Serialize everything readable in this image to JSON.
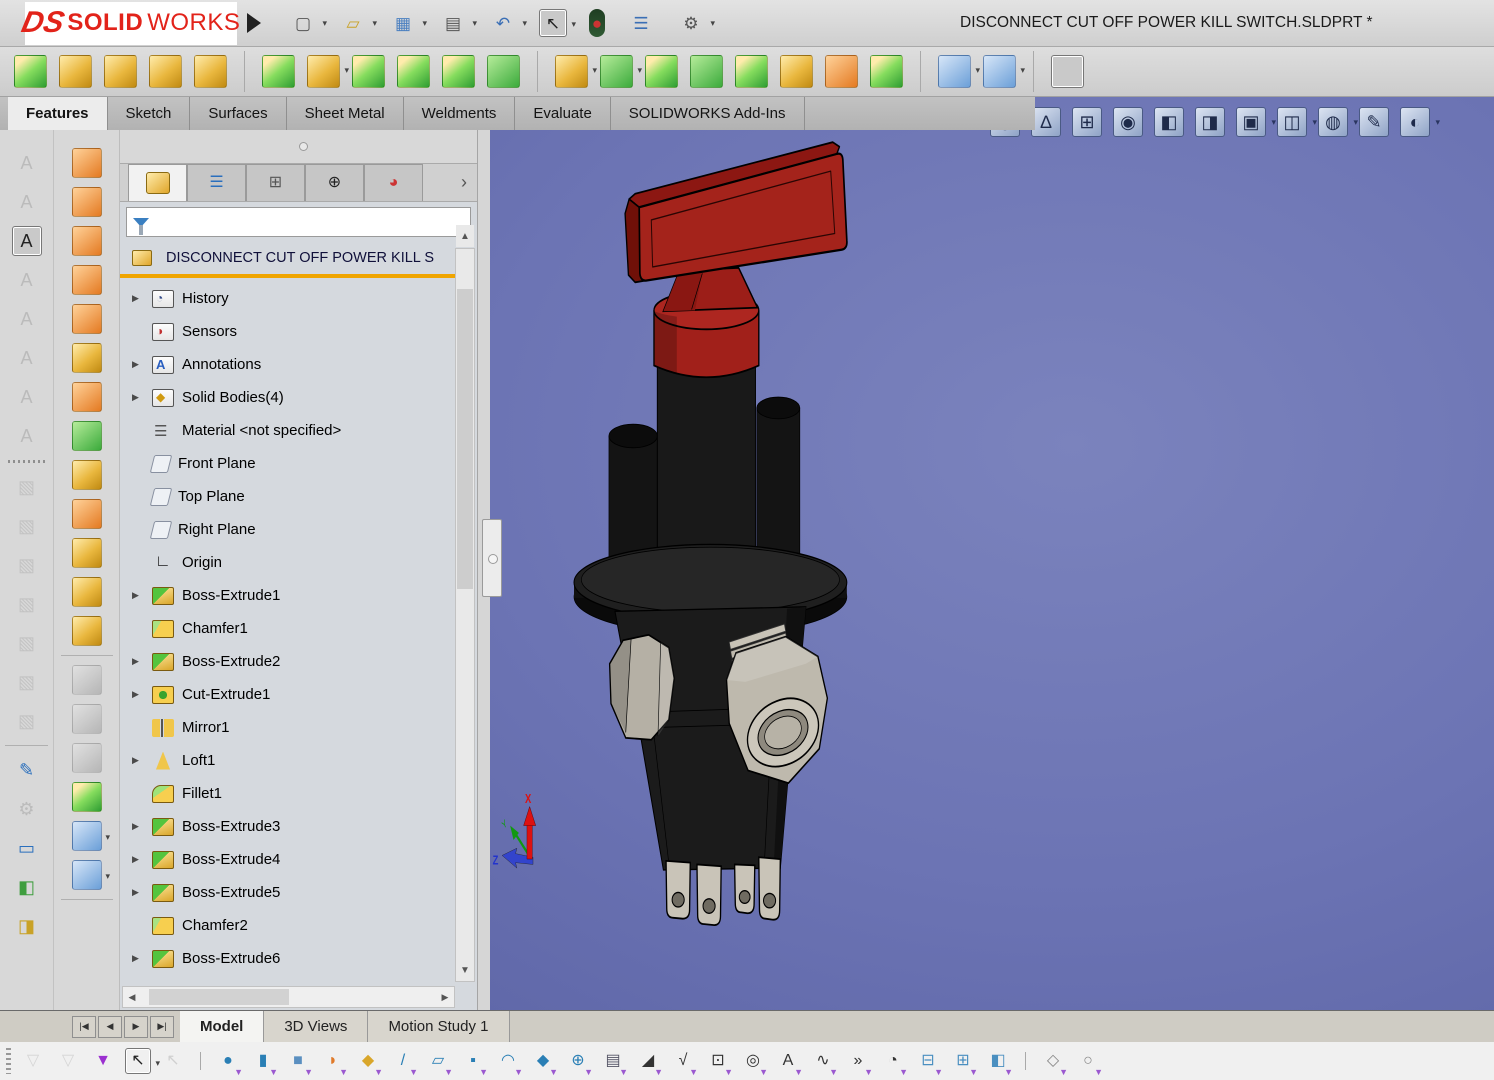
{
  "window": {
    "title": "DISCONNECT CUT OFF POWER KILL SWITCH.SLDPRT *"
  },
  "brand": {
    "prefix": "DS",
    "bold": "SOLID",
    "light": "WORKS"
  },
  "glyphs": {
    "expand": "▶",
    "scroll_up": "▲",
    "scroll_down": "▼",
    "scroll_left": "◀",
    "scroll_right": "▶",
    "chevron_right": "›",
    "nav_first": "|◀",
    "nav_prev": "◀",
    "nav_next": "▶",
    "nav_last": "▶|"
  },
  "quick_access_toolbar": {
    "icons": [
      {
        "name": "new-document-button",
        "glyph": "▢",
        "color": "#555",
        "cls": "",
        "dd": true
      },
      {
        "name": "open-document-button",
        "glyph": "▱",
        "color": "#c9a227",
        "cls": "",
        "dd": true
      },
      {
        "name": "save-button",
        "glyph": "▦",
        "color": "#4a7fc0",
        "cls": "",
        "dd": true
      },
      {
        "name": "print-button",
        "glyph": "▤",
        "color": "#555",
        "cls": "",
        "dd": true
      },
      {
        "name": "undo-button",
        "glyph": "↶",
        "color": "#3b6fb5",
        "cls": "",
        "dd": true
      },
      {
        "name": "select-arrow-button",
        "glyph": "↖",
        "color": "#222",
        "cls": "pressed",
        "dd": true
      },
      {
        "name": "traffic-light-icon",
        "glyph": "●",
        "color": "#cc3333",
        "cls": "traffic"
      },
      {
        "name": "view-settings-button",
        "glyph": "☰",
        "color": "#3b6fb5"
      },
      {
        "name": "options-gear-button",
        "glyph": "⚙",
        "color": "#555",
        "dd": true
      }
    ]
  },
  "features_toolbar": {
    "icons": [
      {
        "name": "extruded-boss-base-button",
        "cls": "chip goldgreen"
      },
      {
        "name": "revolved-boss-base-button",
        "cls": "chip gold"
      },
      {
        "name": "swept-boss-base-button",
        "cls": "chip gold"
      },
      {
        "name": "lofted-boss-base-button",
        "cls": "chip gold"
      },
      {
        "name": "boundary-boss-base-button",
        "cls": "chip gold"
      },
      {
        "sep": true
      },
      {
        "name": "extruded-cut-button",
        "cls": "chip goldgreen"
      },
      {
        "name": "hole-wizard-button",
        "cls": "chip gold",
        "dd": true
      },
      {
        "name": "revolved-cut-button",
        "cls": "chip goldgreen"
      },
      {
        "name": "swept-cut-button",
        "cls": "chip goldgreen"
      },
      {
        "name": "lofted-cut-button",
        "cls": "chip goldgreen"
      },
      {
        "name": "boundary-cut-button",
        "cls": "chip green"
      },
      {
        "sep": true
      },
      {
        "name": "fillet-button",
        "cls": "chip gold",
        "dd": true
      },
      {
        "name": "linear-pattern-button",
        "cls": "chip green",
        "dd": true
      },
      {
        "name": "draft-button",
        "cls": "chip goldgreen"
      },
      {
        "name": "rib-button",
        "cls": "chip green"
      },
      {
        "name": "shell-button",
        "cls": "chip goldgreen"
      },
      {
        "name": "wrap-button",
        "cls": "chip gold"
      },
      {
        "name": "intersect-button",
        "cls": "chip orange"
      },
      {
        "name": "mirror-feature-button",
        "cls": "chip goldgreen"
      },
      {
        "sep": true
      },
      {
        "name": "reference-geometry-button",
        "cls": "chip blue",
        "dd": true
      },
      {
        "name": "curves-button",
        "cls": "chip blue",
        "dd": true
      },
      {
        "sep": true
      },
      {
        "name": "instant3d-button",
        "cls": "chip blue pressed"
      }
    ]
  },
  "ribbon_tabs": {
    "tabs": [
      {
        "label": "Features",
        "active": true
      },
      {
        "label": "Sketch"
      },
      {
        "label": "Surfaces"
      },
      {
        "label": "Sheet Metal"
      },
      {
        "label": "Weldments"
      },
      {
        "label": "Evaluate"
      },
      {
        "label": "SOLIDWORKS Add-Ins"
      }
    ]
  },
  "headsup_toolbar": {
    "icons": [
      {
        "name": "zoom-to-fit-button",
        "glyph": "◎",
        "cls": "steel"
      },
      {
        "name": "measure-button",
        "glyph": "∆",
        "cls": "steel"
      },
      {
        "name": "zoom-to-area-button",
        "glyph": "⊞",
        "cls": "steel"
      },
      {
        "name": "magnified-selection-button",
        "glyph": "◉",
        "cls": "steel"
      },
      {
        "name": "previous-view-button",
        "glyph": "◧",
        "cls": "steel"
      },
      {
        "name": "section-view-button",
        "glyph": "◨",
        "cls": "steel"
      },
      {
        "name": "dynamic-annotation-views-button",
        "glyph": "▣",
        "cls": "steel",
        "dd": true
      },
      {
        "name": "view-orientation-button",
        "glyph": "◫",
        "cls": "steel",
        "dd": true
      },
      {
        "name": "hide-show-items-button",
        "glyph": "◍",
        "cls": "steel",
        "dd": true
      },
      {
        "name": "edit-appearance-button",
        "glyph": "✎",
        "cls": "steel"
      },
      {
        "name": "apply-scene-button",
        "glyph": "◐",
        "cls": "steel",
        "dd": true
      }
    ]
  },
  "left_toolbar_a": {
    "icons": [
      {
        "name": "note-tool-icon-1",
        "glyph": "A",
        "color": "#999",
        "cls": "grayed",
        "inter": false
      },
      {
        "name": "note-tool-icon-2",
        "glyph": "A",
        "color": "#999",
        "cls": "grayed",
        "inter": false
      },
      {
        "name": "spell-checker-button",
        "glyph": "A",
        "color": "#222",
        "cls": "pressed"
      },
      {
        "name": "note-tool-icon-4",
        "glyph": "A",
        "color": "#999",
        "cls": "grayed",
        "inter": false
      },
      {
        "name": "note-tool-icon-5",
        "glyph": "A",
        "color": "#999",
        "cls": "grayed",
        "inter": false
      },
      {
        "name": "note-tool-icon-6",
        "glyph": "A",
        "color": "#999",
        "cls": "grayed",
        "inter": false
      },
      {
        "name": "note-tool-icon-7",
        "glyph": "A",
        "color": "#999",
        "cls": "grayed",
        "inter": false
      },
      {
        "name": "note-tool-icon-8",
        "glyph": "A",
        "color": "#999",
        "cls": "grayed",
        "inter": false
      },
      {
        "sep": "dot"
      },
      {
        "name": "view-cube-icon-1",
        "glyph": "▧",
        "color": "#aaa",
        "cls": "grayed",
        "inter": false
      },
      {
        "name": "view-cube-icon-2",
        "glyph": "▧",
        "color": "#aaa",
        "cls": "grayed",
        "inter": false
      },
      {
        "name": "view-cube-icon-3",
        "glyph": "▧",
        "color": "#aaa",
        "cls": "grayed",
        "inter": false
      },
      {
        "name": "view-cube-icon-4",
        "glyph": "▧",
        "color": "#aaa",
        "cls": "grayed",
        "inter": false
      },
      {
        "name": "view-cube-icon-5",
        "glyph": "▧",
        "color": "#aaa",
        "cls": "grayed",
        "inter": false
      },
      {
        "name": "view-cube-icon-6",
        "glyph": "▧",
        "color": "#aaa",
        "cls": "grayed",
        "inter": false
      },
      {
        "name": "view-cube-icon-7",
        "glyph": "▧",
        "color": "#aaa",
        "cls": "grayed",
        "inter": false
      },
      {
        "sep": true
      },
      {
        "name": "new-sketch-button",
        "glyph": "✎",
        "color": "#2a6fbd"
      },
      {
        "name": "tools-button",
        "glyph": "⚙",
        "color": "#999",
        "cls": "grayed",
        "inter": false
      },
      {
        "name": "viewport-layout-button",
        "glyph": "▭",
        "color": "#2a6fbd"
      },
      {
        "name": "layer-stack-button-1",
        "glyph": "◧",
        "color": "#3f9e3f"
      },
      {
        "name": "layer-stack-button-2",
        "glyph": "◨",
        "color": "#c9a227"
      }
    ]
  },
  "left_toolbar_b": {
    "icons": [
      {
        "name": "extruded-surface-button",
        "cls": "chip orange"
      },
      {
        "name": "revolved-surface-button",
        "cls": "chip orange"
      },
      {
        "name": "swept-surface-button",
        "cls": "chip orange"
      },
      {
        "name": "lofted-surface-button",
        "cls": "chip orange"
      },
      {
        "name": "boundary-surface-button",
        "cls": "chip orange"
      },
      {
        "name": "filled-surface-button",
        "cls": "chip gold"
      },
      {
        "name": "planar-surface-button",
        "cls": "chip orange"
      },
      {
        "name": "offset-surface-button",
        "cls": "chip green"
      },
      {
        "name": "ruled-surface-button",
        "cls": "chip gold"
      },
      {
        "name": "radiate-surface-button",
        "cls": "chip orange"
      },
      {
        "name": "delete-face-button",
        "cls": "chip gold"
      },
      {
        "name": "replace-face-button",
        "cls": "chip gold"
      },
      {
        "name": "knit-surface-button",
        "cls": "chip gold"
      },
      {
        "sep": true
      },
      {
        "name": "extend-surface-button",
        "cls": "chip gold grayed",
        "inter": false
      },
      {
        "name": "trim-surface-button",
        "cls": "chip gold grayed",
        "inter": false
      },
      {
        "name": "untrim-surface-button",
        "cls": "chip gold grayed",
        "inter": false
      },
      {
        "name": "thicken-button",
        "cls": "chip goldgreen"
      },
      {
        "name": "reference-geometry-side-button",
        "cls": "chip blue",
        "dd": true
      },
      {
        "name": "curves-side-button",
        "cls": "chip blue",
        "dd": true
      },
      {
        "sep": true
      }
    ]
  },
  "feature_manager": {
    "panel_tabs": [
      {
        "name": "featuremanager-design-tree-tab",
        "cls": "ti-part",
        "active": true
      },
      {
        "name": "propertymanager-tab",
        "glyph": "☰",
        "color": "#2a6fbd"
      },
      {
        "name": "configurationmanager-tab",
        "glyph": "⊞",
        "color": "#555"
      },
      {
        "name": "dimxpertmanager-tab",
        "glyph": "⊕",
        "color": "#222"
      },
      {
        "name": "displaymanager-tab",
        "glyph": "◕",
        "color": "#cc3333"
      }
    ],
    "filter_value": "",
    "root": {
      "label": "DISCONNECT CUT OFF POWER KILL S"
    },
    "items": [
      {
        "label": "History",
        "icon": "history",
        "expandable": true
      },
      {
        "label": "Sensors",
        "icon": "sensors"
      },
      {
        "label": "Annotations",
        "icon": "annotations",
        "expandable": true
      },
      {
        "label": "Solid Bodies(4)",
        "icon": "solidbodies",
        "expandable": true
      },
      {
        "label": "Material <not specified>",
        "icon": "material"
      },
      {
        "label": "Front Plane",
        "icon": "plane"
      },
      {
        "label": "Top Plane",
        "icon": "plane"
      },
      {
        "label": "Right Plane",
        "icon": "plane"
      },
      {
        "label": "Origin",
        "icon": "origin"
      },
      {
        "label": "Boss-Extrude1",
        "icon": "boss",
        "expandable": true
      },
      {
        "label": "Chamfer1",
        "icon": "chamfer"
      },
      {
        "label": "Boss-Extrude2",
        "icon": "boss",
        "expandable": true
      },
      {
        "label": "Cut-Extrude1",
        "icon": "cut",
        "expandable": true
      },
      {
        "label": "Mirror1",
        "icon": "mirror"
      },
      {
        "label": "Loft1",
        "icon": "loft",
        "expandable": true
      },
      {
        "label": "Fillet1",
        "icon": "fillet"
      },
      {
        "label": "Boss-Extrude3",
        "icon": "boss",
        "expandable": true
      },
      {
        "label": "Boss-Extrude4",
        "icon": "boss",
        "expandable": true
      },
      {
        "label": "Boss-Extrude5",
        "icon": "boss",
        "expandable": true
      },
      {
        "label": "Chamfer2",
        "icon": "chamfer"
      },
      {
        "label": "Boss-Extrude6",
        "icon": "boss",
        "expandable": true
      }
    ]
  },
  "viewport": {
    "background_center": "#7b83bd",
    "background_edge": "#565ea0",
    "model": {
      "description": "battery disconnect kill switch",
      "handle_color": "#a4231b",
      "body_color": "#1b1b1b",
      "metal_color": "#c3beb2"
    },
    "triad": {
      "x": "X",
      "y": "Y",
      "z": "Z",
      "x_color": "#dd1111",
      "y_color": "#119911",
      "z_color": "#3344cc"
    }
  },
  "bottom_tabs": {
    "tabs": [
      {
        "label": "Model",
        "active": true
      },
      {
        "label": "3D Views"
      },
      {
        "label": "Motion Study 1"
      }
    ]
  },
  "selection_filter_toolbar": {
    "icons": [
      {
        "name": "filter-clear-all-button",
        "glyph": "▽",
        "color": "#b5b5b5",
        "cls": "grayed",
        "inter": false
      },
      {
        "name": "filter-invert-button",
        "glyph": "▽",
        "color": "#b5b5b5",
        "cls": "grayed",
        "inter": false
      },
      {
        "name": "toggle-selection-filters-button",
        "glyph": "▼",
        "color": "#9b30d0"
      },
      {
        "name": "select-button",
        "glyph": "↖",
        "color": "#222",
        "cls": "pressed",
        "dd": true
      },
      {
        "name": "lasso-select-button",
        "glyph": "↖",
        "color": "#aaa",
        "cls": "grayed",
        "inter": false
      },
      {
        "sep": true
      },
      {
        "name": "filter-vertices-button",
        "glyph": "●",
        "color": "#2a7fb5",
        "badge": true
      },
      {
        "name": "filter-edges-button",
        "glyph": "▮",
        "color": "#2a7fb5",
        "badge": true
      },
      {
        "name": "filter-faces-button",
        "glyph": "■",
        "color": "#5a8fc0",
        "badge": true
      },
      {
        "name": "filter-surface-bodies-button",
        "glyph": "◗",
        "color": "#e07a2a",
        "badge": true
      },
      {
        "name": "filter-solid-bodies-button",
        "glyph": "◆",
        "color": "#d9a62a",
        "badge": true
      },
      {
        "name": "filter-axes-button",
        "glyph": "/",
        "color": "#2a7fb5",
        "badge": true
      },
      {
        "name": "filter-planes-button",
        "glyph": "▱",
        "color": "#2a7fb5",
        "badge": true
      },
      {
        "name": "filter-sketch-points-button",
        "glyph": "▪",
        "color": "#2a7fb5",
        "badge": true
      },
      {
        "name": "filter-sketch-segments-button",
        "glyph": "◠",
        "color": "#2a7fb5",
        "badge": true
      },
      {
        "name": "filter-midpoints-button",
        "glyph": "◆",
        "color": "#2a7fb5",
        "badge": true
      },
      {
        "name": "filter-center-marks-button",
        "glyph": "⊕",
        "color": "#2a7fb5",
        "badge": true
      },
      {
        "name": "filter-reference-planes-button",
        "glyph": "▤",
        "color": "#556",
        "badge": true
      },
      {
        "name": "filter-dimensions-button",
        "glyph": "◢",
        "color": "#333",
        "badge": true
      },
      {
        "name": "filter-surface-finish-button",
        "glyph": "√",
        "color": "#333",
        "badge": true
      },
      {
        "name": "filter-geometric-tolerances-button",
        "glyph": "⊡",
        "color": "#333",
        "badge": true
      },
      {
        "name": "filter-notes-button",
        "glyph": "◎",
        "color": "#333",
        "badge": true
      },
      {
        "name": "filter-annotations-button",
        "glyph": "A",
        "color": "#333",
        "badge": true
      },
      {
        "name": "filter-weld-symbols-button",
        "glyph": "∿",
        "color": "#333",
        "badge": true
      },
      {
        "name": "filter-datum-targets-button",
        "glyph": "»",
        "color": "#333",
        "badge": true
      },
      {
        "name": "filter-blocks-button",
        "glyph": "◔",
        "color": "#333",
        "badge": true
      },
      {
        "name": "filter-connection-points-button",
        "glyph": "⊟",
        "color": "#4a8fc0",
        "badge": true
      },
      {
        "name": "filter-routing-points-button",
        "glyph": "⊞",
        "color": "#4a8fc0",
        "badge": true
      },
      {
        "name": "filter-smart-components-button",
        "glyph": "◧",
        "color": "#4a8fc0",
        "badge": true
      },
      {
        "sep": true
      },
      {
        "name": "filter-mate-references-button",
        "glyph": "◇",
        "color": "#888",
        "badge": true
      },
      {
        "name": "filter-sketch-blocks-button",
        "glyph": "○",
        "color": "#888",
        "badge": true
      }
    ]
  }
}
